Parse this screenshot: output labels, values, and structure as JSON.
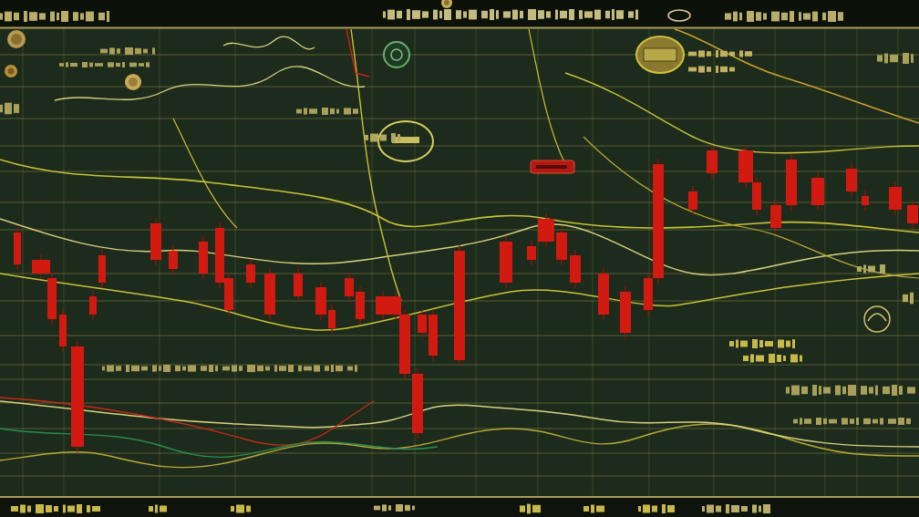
{
  "chart": {
    "kind": "candlestick"
  }
}
